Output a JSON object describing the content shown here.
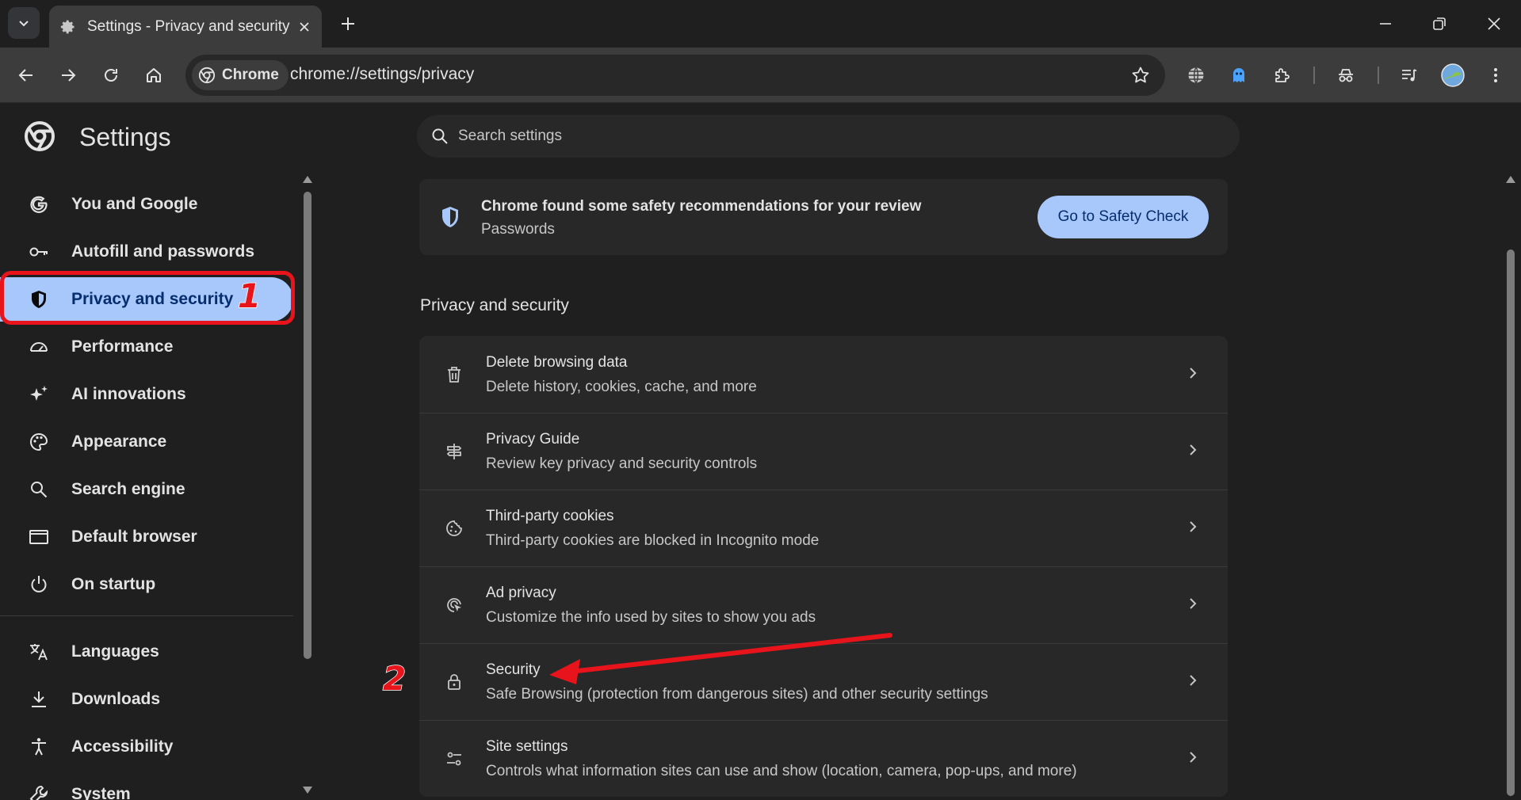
{
  "tab": {
    "title": "Settings - Privacy and security"
  },
  "toolbar": {
    "chip_label": "Chrome",
    "url": "chrome://settings/privacy"
  },
  "header": {
    "title": "Settings",
    "search_placeholder": "Search settings"
  },
  "sidebar": {
    "items": [
      {
        "label": "You and Google",
        "icon": "google-g-icon"
      },
      {
        "label": "Autofill and passwords",
        "icon": "key-icon"
      },
      {
        "label": "Privacy and security",
        "icon": "shield-icon",
        "active": true
      },
      {
        "label": "Performance",
        "icon": "speedometer-icon"
      },
      {
        "label": "AI innovations",
        "icon": "sparkle-icon"
      },
      {
        "label": "Appearance",
        "icon": "palette-icon"
      },
      {
        "label": "Search engine",
        "icon": "search-icon"
      },
      {
        "label": "Default browser",
        "icon": "browser-window-icon"
      },
      {
        "label": "On startup",
        "icon": "power-icon"
      },
      {
        "label": "Languages",
        "icon": "translate-icon"
      },
      {
        "label": "Downloads",
        "icon": "download-icon"
      },
      {
        "label": "Accessibility",
        "icon": "accessibility-icon"
      },
      {
        "label": "System",
        "icon": "wrench-icon"
      }
    ]
  },
  "banner": {
    "title": "Chrome found some safety recommendations for your review",
    "subtitle": "Passwords",
    "button_label": "Go to Safety Check"
  },
  "section": {
    "title": "Privacy and security"
  },
  "rows": [
    {
      "title": "Delete browsing data",
      "subtitle": "Delete history, cookies, cache, and more",
      "icon": "trash-icon"
    },
    {
      "title": "Privacy Guide",
      "subtitle": "Review key privacy and security controls",
      "icon": "signpost-icon"
    },
    {
      "title": "Third-party cookies",
      "subtitle": "Third-party cookies are blocked in Incognito mode",
      "icon": "cookie-icon"
    },
    {
      "title": "Ad privacy",
      "subtitle": "Customize the info used by sites to show you ads",
      "icon": "ad-target-icon"
    },
    {
      "title": "Security",
      "subtitle": "Safe Browsing (protection from dangerous sites) and other security settings",
      "icon": "lock-icon"
    },
    {
      "title": "Site settings",
      "subtitle": "Controls what information sites can use and show (location, camera, pop-ups, and more)",
      "icon": "sliders-icon"
    }
  ],
  "annotations": {
    "marker_1": "1",
    "marker_2": "2"
  },
  "colors": {
    "accent": "#a8c7fa",
    "annotation_red": "#e8141b",
    "background": "#1f1f1f",
    "card": "#282828"
  }
}
